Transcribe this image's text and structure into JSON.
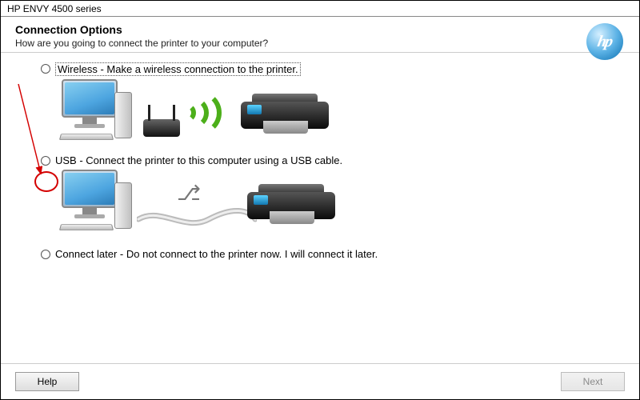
{
  "window": {
    "title": "HP ENVY 4500 series"
  },
  "brand": {
    "logo_text": "hp"
  },
  "header": {
    "title": "Connection Options",
    "subtitle": "How are you going to connect the printer to your computer?"
  },
  "options": {
    "wireless": {
      "label": "Wireless - Make a wireless connection to the printer."
    },
    "usb": {
      "label": "USB - Connect the printer to this computer using a USB cable."
    },
    "later": {
      "label": "Connect later - Do not connect to the printer now. I will connect it later."
    }
  },
  "buttons": {
    "help": "Help",
    "next": "Next"
  },
  "state": {
    "next_enabled": false
  },
  "colors": {
    "accent_green": "#4caf1a",
    "annotation_red": "#d40000",
    "hp_blue": "#1c8dd4"
  }
}
